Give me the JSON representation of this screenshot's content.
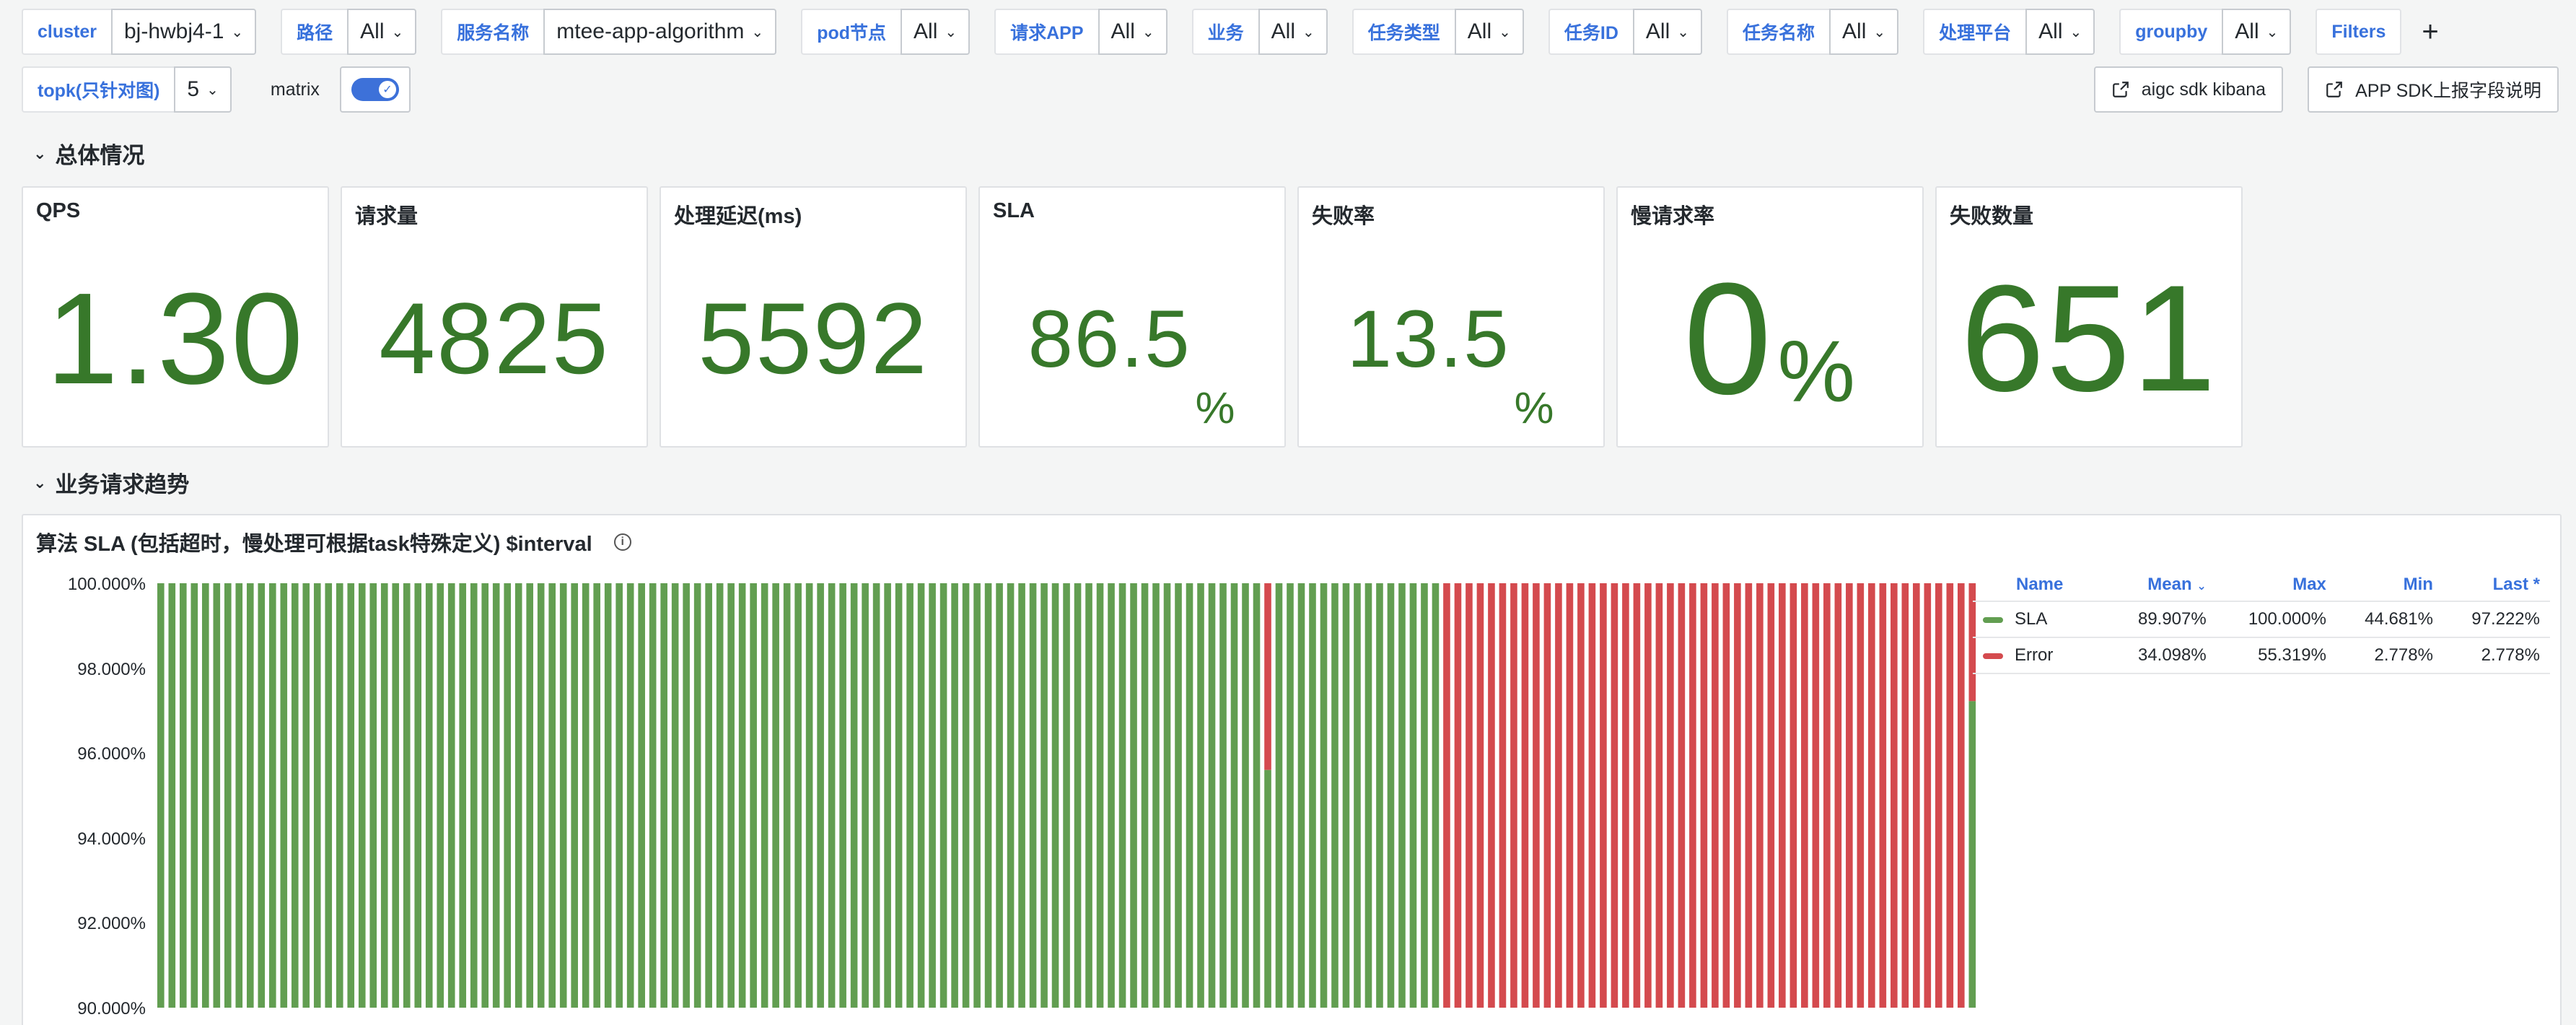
{
  "variables_row1": [
    {
      "label": "cluster",
      "value": "bj-hwbj4-1"
    },
    {
      "label": "路径",
      "value": "All"
    },
    {
      "label": "服务名称",
      "value": "mtee-app-algorithm"
    },
    {
      "label": "pod节点",
      "value": "All"
    },
    {
      "label": "请求APP",
      "value": "All"
    },
    {
      "label": "业务",
      "value": "All"
    },
    {
      "label": "任务类型",
      "value": "All"
    },
    {
      "label": "任务ID",
      "value": "All"
    },
    {
      "label": "任务名称",
      "value": "All"
    },
    {
      "label": "处理平台",
      "value": "All"
    },
    {
      "label": "groupby",
      "value": "All"
    }
  ],
  "filters_label": "Filters",
  "plus_label": "+",
  "topk": {
    "label": "topk(只针对图)",
    "value": "5"
  },
  "matrix": {
    "label": "matrix",
    "enabled": true
  },
  "links": {
    "kibana": "aigc sdk kibana",
    "sdk_doc": "APP SDK上报字段说明"
  },
  "rows": {
    "overview": "总体情况",
    "trend": "业务请求趋势"
  },
  "stats": [
    {
      "title": "QPS",
      "value": "1.30",
      "unit": "",
      "size": 180
    },
    {
      "title": "请求量",
      "value": "4825",
      "unit": "",
      "size": 140
    },
    {
      "title": "处理延迟(ms)",
      "value": "5592",
      "unit": "",
      "size": 140
    },
    {
      "title": "SLA",
      "value": "86.5",
      "unit": "%",
      "size": 112
    },
    {
      "title": "失败率",
      "value": "13.5",
      "unit": "%",
      "size": 112
    },
    {
      "title": "慢请求率",
      "value": "0",
      "unit": "%",
      "size": 220
    },
    {
      "title": "失败数量",
      "value": "651",
      "unit": "",
      "size": 210
    }
  ],
  "timeseries": {
    "title": "算法 SLA (包括超时，慢处理可根据task特殊定义) $interval",
    "legend_headers": {
      "name": "Name",
      "mean": "Mean",
      "max": "Max",
      "min": "Min",
      "last": "Last *"
    },
    "legend_rows": [
      {
        "name": "SLA",
        "color": "#629e51",
        "mean": "89.907%",
        "max": "100.000%",
        "min": "44.681%",
        "last": "97.222%"
      },
      {
        "name": "Error",
        "color": "#d44a4e",
        "mean": "34.098%",
        "max": "55.319%",
        "min": "2.778%",
        "last": "2.778%"
      }
    ]
  },
  "chart_data": {
    "type": "bar",
    "title": "算法 SLA (包括超时，慢处理可根据task特殊定义) $interval",
    "ylabel": "",
    "xlabel": "",
    "ylim": [
      90,
      100
    ],
    "yticks": [
      "100.000%",
      "98.000%",
      "96.000%",
      "94.000%",
      "92.000%",
      "90.000%"
    ],
    "grid": false,
    "legend": "right",
    "stacked": true,
    "bar_count": 163,
    "series": [
      {
        "name": "SLA",
        "color": "#629e51",
        "note": "100% for bars 1-100 (bar 100 shows SLA below ~95.6%), 100% for bars 101-115, below 90% for bars 116-162, 97.2% for last bar"
      },
      {
        "name": "Error",
        "color": "#d44a4e"
      }
    ],
    "segments": [
      {
        "from": 1,
        "to": 99,
        "sla_top": 100
      },
      {
        "from": 100,
        "to": 100,
        "sla_top": 95.6
      },
      {
        "from": 101,
        "to": 115,
        "sla_top": 100
      },
      {
        "from": 116,
        "to": 162,
        "sla_top": 90
      },
      {
        "from": 163,
        "to": 163,
        "sla_top": 97.222
      }
    ]
  }
}
